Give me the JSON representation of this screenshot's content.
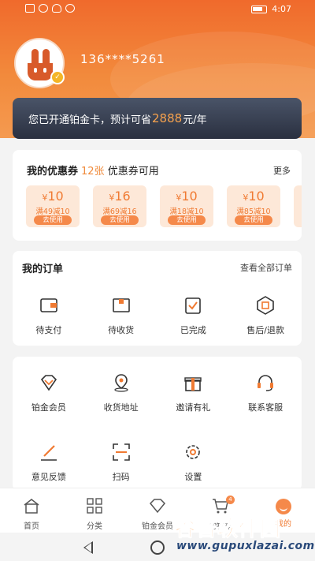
{
  "status": {
    "time": "4:07"
  },
  "profile": {
    "phone": "136****5261"
  },
  "gold_card": {
    "text_before": "您已开通铂金卡，预计可省",
    "amount": "2888",
    "text_after": "元/年"
  },
  "coupons": {
    "title": "我的优惠券",
    "count": "12张",
    "suffix": "优惠券可用",
    "more": "更多",
    "items": [
      {
        "currency": "¥",
        "amount": "10",
        "condition": "满49减10",
        "action": "去使用"
      },
      {
        "currency": "¥",
        "amount": "16",
        "condition": "满69减16",
        "action": "去使用"
      },
      {
        "currency": "¥",
        "amount": "10",
        "condition": "满18减10",
        "action": "去使用"
      },
      {
        "currency": "¥",
        "amount": "10",
        "condition": "满85减10",
        "action": "去使用"
      }
    ]
  },
  "orders": {
    "title": "我的订单",
    "view_all": "查看全部订单",
    "items": [
      {
        "label": "待支付",
        "icon": "wallet-icon"
      },
      {
        "label": "待收货",
        "icon": "package-icon"
      },
      {
        "label": "已完成",
        "icon": "clipboard-check-icon"
      },
      {
        "label": "售后/退款",
        "icon": "refund-icon"
      }
    ]
  },
  "services": {
    "items": [
      {
        "label": "铂金会员",
        "icon": "diamond-icon"
      },
      {
        "label": "收货地址",
        "icon": "location-icon"
      },
      {
        "label": "邀请有礼",
        "icon": "gift-icon"
      },
      {
        "label": "联系客服",
        "icon": "headset-icon"
      },
      {
        "label": "意见反馈",
        "icon": "feedback-pen-icon"
      },
      {
        "label": "扫码",
        "icon": "scan-icon"
      },
      {
        "label": "设置",
        "icon": "gear-icon"
      }
    ]
  },
  "tabbar": {
    "items": [
      {
        "label": "首页",
        "icon": "home-icon"
      },
      {
        "label": "分类",
        "icon": "category-grid-icon"
      },
      {
        "label": "铂金会员",
        "icon": "diamond-icon"
      },
      {
        "label": "购物车",
        "icon": "cart-icon",
        "badge": "4"
      },
      {
        "label": "我的",
        "icon": "smiley-icon",
        "active": true
      }
    ]
  },
  "watermark": {
    "title": "谷普软件园",
    "url": "www.gupuxlazai.com"
  },
  "colors": {
    "accent": "#f07a32",
    "hero_top": "#f06a2c",
    "card_dark": "#2a3040"
  }
}
